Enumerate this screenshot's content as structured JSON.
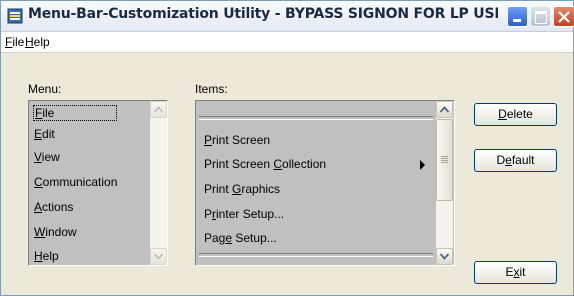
{
  "window": {
    "title": "Menu-Bar-Customization Utility - BYPASS SIGNON FOR LP USE..."
  },
  "menubar": {
    "items": [
      {
        "label": "File"
      },
      {
        "label": "Help"
      }
    ]
  },
  "labels": {
    "menu": "Menu:",
    "items": "Items:"
  },
  "menu_list": {
    "items": [
      {
        "label": "File",
        "selected": true
      },
      {
        "label": "Edit"
      },
      {
        "label": "View"
      },
      {
        "label": "Communication"
      },
      {
        "label": "Actions"
      },
      {
        "label": "Window"
      },
      {
        "label": "Help"
      }
    ]
  },
  "items_list": {
    "items": [
      {
        "pre": "",
        "u": "P",
        "post": "rint Screen",
        "submenu": false
      },
      {
        "pre": "Print Screen ",
        "u": "C",
        "post": "ollection",
        "submenu": true
      },
      {
        "pre": "Print ",
        "u": "G",
        "post": "raphics",
        "submenu": false
      },
      {
        "pre": "P",
        "u": "r",
        "post": "inter Setup...",
        "submenu": false
      },
      {
        "pre": "Pag",
        "u": "e",
        "post": " Setup...",
        "submenu": false
      }
    ]
  },
  "buttons": {
    "delete": {
      "pre": "",
      "u": "D",
      "post": "elete"
    },
    "default": {
      "pre": "D",
      "u": "e",
      "post": "fault"
    },
    "exit": {
      "pre": "E",
      "u": "x",
      "post": "it"
    }
  },
  "colors": {
    "list_bg": "#c0c0c0",
    "window_bg": "#ece9d8",
    "title_text": "#1a2a45",
    "close_button": "#c2401f"
  },
  "icons": {
    "app": "app-window-icon",
    "minimize": "minimize-icon",
    "maximize": "maximize-icon",
    "close": "close-icon",
    "submenu": "submenu-arrow-icon",
    "scroll_up": "scroll-up-icon",
    "scroll_down": "scroll-down-icon"
  }
}
